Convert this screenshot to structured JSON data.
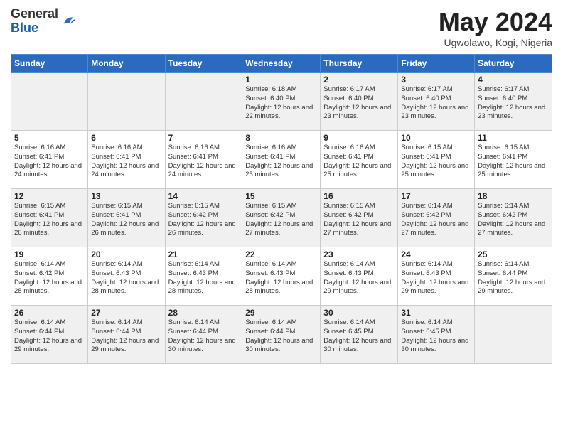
{
  "header": {
    "logo": {
      "general": "General",
      "blue": "Blue"
    },
    "title": "May 2024",
    "location": "Ugwolawo, Kogi, Nigeria"
  },
  "days_of_week": [
    "Sunday",
    "Monday",
    "Tuesday",
    "Wednesday",
    "Thursday",
    "Friday",
    "Saturday"
  ],
  "weeks": [
    [
      {
        "day": "",
        "info": ""
      },
      {
        "day": "",
        "info": ""
      },
      {
        "day": "",
        "info": ""
      },
      {
        "day": "1",
        "info": "Sunrise: 6:18 AM\nSunset: 6:40 PM\nDaylight: 12 hours\nand 22 minutes."
      },
      {
        "day": "2",
        "info": "Sunrise: 6:17 AM\nSunset: 6:40 PM\nDaylight: 12 hours\nand 23 minutes."
      },
      {
        "day": "3",
        "info": "Sunrise: 6:17 AM\nSunset: 6:40 PM\nDaylight: 12 hours\nand 23 minutes."
      },
      {
        "day": "4",
        "info": "Sunrise: 6:17 AM\nSunset: 6:40 PM\nDaylight: 12 hours\nand 23 minutes."
      }
    ],
    [
      {
        "day": "5",
        "info": "Sunrise: 6:16 AM\nSunset: 6:41 PM\nDaylight: 12 hours\nand 24 minutes."
      },
      {
        "day": "6",
        "info": "Sunrise: 6:16 AM\nSunset: 6:41 PM\nDaylight: 12 hours\nand 24 minutes."
      },
      {
        "day": "7",
        "info": "Sunrise: 6:16 AM\nSunset: 6:41 PM\nDaylight: 12 hours\nand 24 minutes."
      },
      {
        "day": "8",
        "info": "Sunrise: 6:16 AM\nSunset: 6:41 PM\nDaylight: 12 hours\nand 25 minutes."
      },
      {
        "day": "9",
        "info": "Sunrise: 6:16 AM\nSunset: 6:41 PM\nDaylight: 12 hours\nand 25 minutes."
      },
      {
        "day": "10",
        "info": "Sunrise: 6:15 AM\nSunset: 6:41 PM\nDaylight: 12 hours\nand 25 minutes."
      },
      {
        "day": "11",
        "info": "Sunrise: 6:15 AM\nSunset: 6:41 PM\nDaylight: 12 hours\nand 25 minutes."
      }
    ],
    [
      {
        "day": "12",
        "info": "Sunrise: 6:15 AM\nSunset: 6:41 PM\nDaylight: 12 hours\nand 26 minutes."
      },
      {
        "day": "13",
        "info": "Sunrise: 6:15 AM\nSunset: 6:41 PM\nDaylight: 12 hours\nand 26 minutes."
      },
      {
        "day": "14",
        "info": "Sunrise: 6:15 AM\nSunset: 6:42 PM\nDaylight: 12 hours\nand 26 minutes."
      },
      {
        "day": "15",
        "info": "Sunrise: 6:15 AM\nSunset: 6:42 PM\nDaylight: 12 hours\nand 27 minutes."
      },
      {
        "day": "16",
        "info": "Sunrise: 6:15 AM\nSunset: 6:42 PM\nDaylight: 12 hours\nand 27 minutes."
      },
      {
        "day": "17",
        "info": "Sunrise: 6:14 AM\nSunset: 6:42 PM\nDaylight: 12 hours\nand 27 minutes."
      },
      {
        "day": "18",
        "info": "Sunrise: 6:14 AM\nSunset: 6:42 PM\nDaylight: 12 hours\nand 27 minutes."
      }
    ],
    [
      {
        "day": "19",
        "info": "Sunrise: 6:14 AM\nSunset: 6:42 PM\nDaylight: 12 hours\nand 28 minutes."
      },
      {
        "day": "20",
        "info": "Sunrise: 6:14 AM\nSunset: 6:43 PM\nDaylight: 12 hours\nand 28 minutes."
      },
      {
        "day": "21",
        "info": "Sunrise: 6:14 AM\nSunset: 6:43 PM\nDaylight: 12 hours\nand 28 minutes."
      },
      {
        "day": "22",
        "info": "Sunrise: 6:14 AM\nSunset: 6:43 PM\nDaylight: 12 hours\nand 28 minutes."
      },
      {
        "day": "23",
        "info": "Sunrise: 6:14 AM\nSunset: 6:43 PM\nDaylight: 12 hours\nand 29 minutes."
      },
      {
        "day": "24",
        "info": "Sunrise: 6:14 AM\nSunset: 6:43 PM\nDaylight: 12 hours\nand 29 minutes."
      },
      {
        "day": "25",
        "info": "Sunrise: 6:14 AM\nSunset: 6:44 PM\nDaylight: 12 hours\nand 29 minutes."
      }
    ],
    [
      {
        "day": "26",
        "info": "Sunrise: 6:14 AM\nSunset: 6:44 PM\nDaylight: 12 hours\nand 29 minutes."
      },
      {
        "day": "27",
        "info": "Sunrise: 6:14 AM\nSunset: 6:44 PM\nDaylight: 12 hours\nand 29 minutes."
      },
      {
        "day": "28",
        "info": "Sunrise: 6:14 AM\nSunset: 6:44 PM\nDaylight: 12 hours\nand 30 minutes."
      },
      {
        "day": "29",
        "info": "Sunrise: 6:14 AM\nSunset: 6:44 PM\nDaylight: 12 hours\nand 30 minutes."
      },
      {
        "day": "30",
        "info": "Sunrise: 6:14 AM\nSunset: 6:45 PM\nDaylight: 12 hours\nand 30 minutes."
      },
      {
        "day": "31",
        "info": "Sunrise: 6:14 AM\nSunset: 6:45 PM\nDaylight: 12 hours\nand 30 minutes."
      },
      {
        "day": "",
        "info": ""
      }
    ]
  ]
}
